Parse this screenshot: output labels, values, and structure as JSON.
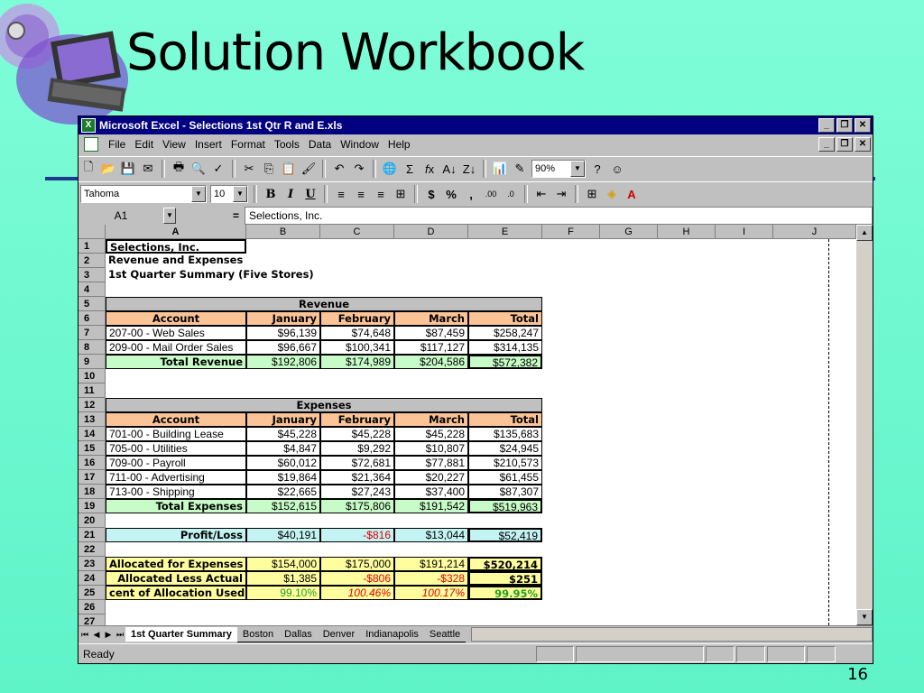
{
  "slide": {
    "title": "Solution Workbook",
    "number": "16"
  },
  "window": {
    "title": "Microsoft Excel - Selections 1st Qtr R and E.xls",
    "minimize": "_",
    "restore": "❐",
    "close": "✕"
  },
  "menu": [
    "File",
    "Edit",
    "View",
    "Insert",
    "Format",
    "Tools",
    "Data",
    "Window",
    "Help"
  ],
  "toolbar": {
    "zoom": "90%",
    "font": "Tahoma",
    "font_size": "10",
    "bold": "B",
    "italic": "I",
    "underline": "U",
    "currency": "$",
    "percent": "%",
    "comma": ",",
    "inc_decimal": ".00",
    "dec_decimal": ".0"
  },
  "formula_bar": {
    "cell_ref": "A1",
    "equals": "=",
    "content": "Selections, Inc."
  },
  "columns": [
    "A",
    "B",
    "C",
    "D",
    "E",
    "F",
    "G",
    "H",
    "I",
    "J"
  ],
  "rows": [
    "1",
    "2",
    "3",
    "4",
    "5",
    "6",
    "7",
    "8",
    "9",
    "10",
    "11",
    "12",
    "13",
    "14",
    "15",
    "16",
    "17",
    "18",
    "19",
    "20",
    "21",
    "22",
    "23",
    "24",
    "25",
    "26",
    "27"
  ],
  "sheet": {
    "a1": "Selections, Inc.",
    "a2": "Revenue and Expenses",
    "a3": "1st Quarter Summary (Five Stores)",
    "revenue_header": "Revenue",
    "revenue_cols": [
      "Account",
      "January",
      "February",
      "March",
      "Total"
    ],
    "revenue_rows": [
      [
        "207-00 - Web Sales",
        "$96,139",
        "$74,648",
        "$87,459",
        "$258,247"
      ],
      [
        "209-00 - Mail Order Sales",
        "$96,667",
        "$100,341",
        "$117,127",
        "$314,135"
      ]
    ],
    "total_revenue": [
      "Total Revenue",
      "$192,806",
      "$174,989",
      "$204,586",
      "$572,382"
    ],
    "expenses_header": "Expenses",
    "expense_cols": [
      "Account",
      "January",
      "February",
      "March",
      "Total"
    ],
    "expense_rows": [
      [
        "701-00 - Building Lease",
        "$45,228",
        "$45,228",
        "$45,228",
        "$135,683"
      ],
      [
        "705-00 - Utilities",
        "$4,847",
        "$9,292",
        "$10,807",
        "$24,945"
      ],
      [
        "709-00 - Payroll",
        "$60,012",
        "$72,681",
        "$77,881",
        "$210,573"
      ],
      [
        "711-00 - Advertising",
        "$19,864",
        "$21,364",
        "$20,227",
        "$61,455"
      ],
      [
        "713-00 - Shipping",
        "$22,665",
        "$27,243",
        "$37,400",
        "$87,307"
      ]
    ],
    "total_expenses": [
      "Total Expenses",
      "$152,615",
      "$175,806",
      "$191,542",
      "$519,963"
    ],
    "profit_loss": [
      "Profit/Loss",
      "$40,191",
      "-$816",
      "$13,044",
      "$52,419"
    ],
    "allocated": [
      "Allocated for Expenses",
      "$154,000",
      "$175,000",
      "$191,214",
      "$520,214"
    ],
    "allocated_less": [
      "Allocated Less Actual",
      "$1,385",
      "-$806",
      "-$328",
      "$251"
    ],
    "pct_allocation": [
      "cent of Allocation Used",
      "99.10%",
      "100.46%",
      "100.17%",
      "99.95%"
    ]
  },
  "tabs": [
    "1st Quarter Summary",
    "Boston",
    "Dallas",
    "Denver",
    "Indianapolis",
    "Seattle"
  ],
  "status": "Ready"
}
